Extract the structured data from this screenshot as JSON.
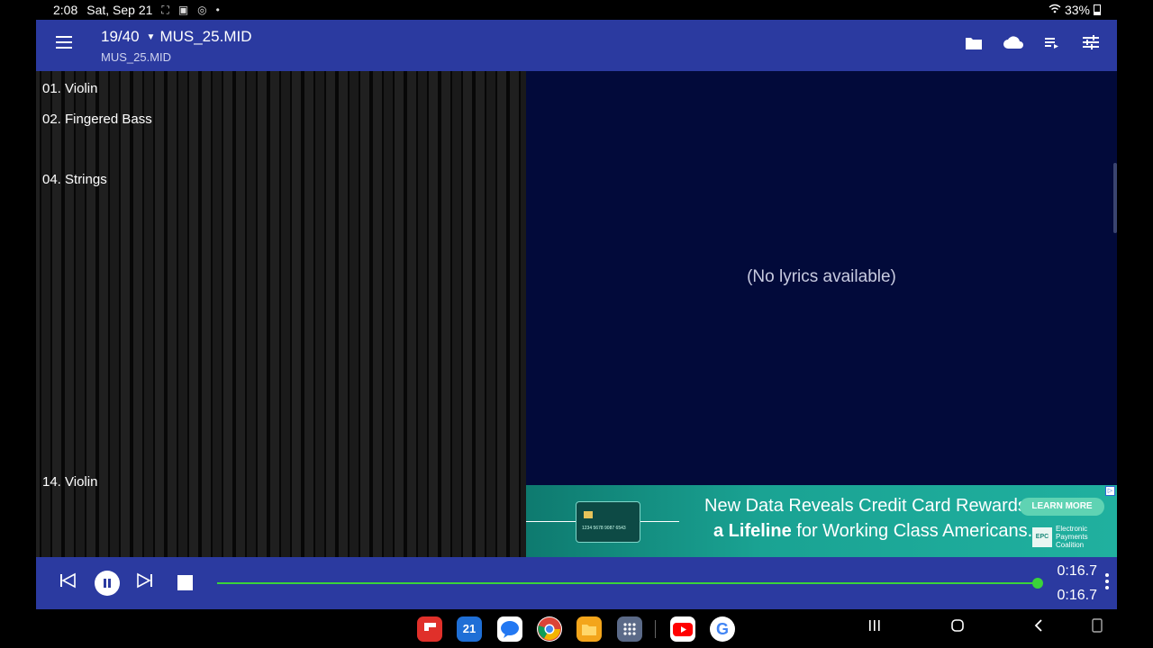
{
  "status": {
    "time": "2:08",
    "date": "Sat, Sep 21",
    "battery": "33%"
  },
  "header": {
    "title": "19/40",
    "filename": "MUS_25.MID",
    "subtitle": "MUS_25.MID"
  },
  "tracks": [
    {
      "label": "01. Violin"
    },
    {
      "label": "02. Fingered Bass"
    },
    {
      "label": "04. Strings"
    },
    {
      "label": "14. Violin"
    }
  ],
  "lyrics": {
    "empty_text": "(No lyrics available)"
  },
  "ad": {
    "line1": "New Data Reveals Credit Card Rewards Are",
    "line2_bold": "a Lifeline",
    "line2_rest": " for Working Class Americans.",
    "cta": "LEARN MORE",
    "brand_mark": "EPC",
    "brand": "Electronic Payments Coalition",
    "card_number": "1234 5678 9087 6543"
  },
  "player": {
    "elapsed": "0:16.7",
    "total": "0:16.7",
    "progress": 1.0
  },
  "colors": {
    "appbar": "#2b3aa0",
    "lyrics_bg": "#020a3a",
    "progress": "#3ad33a"
  },
  "icons": {
    "toolbar": [
      "folder-icon",
      "cloud-icon",
      "playlist-icon",
      "equalizer-settings-icon"
    ],
    "dock": [
      "flipboard-icon",
      "calendar-icon",
      "messages-icon",
      "chrome-icon",
      "files-icon",
      "app-drawer-icon",
      "youtube-icon",
      "google-icon"
    ]
  },
  "dock": {
    "calendar_day": "21"
  }
}
